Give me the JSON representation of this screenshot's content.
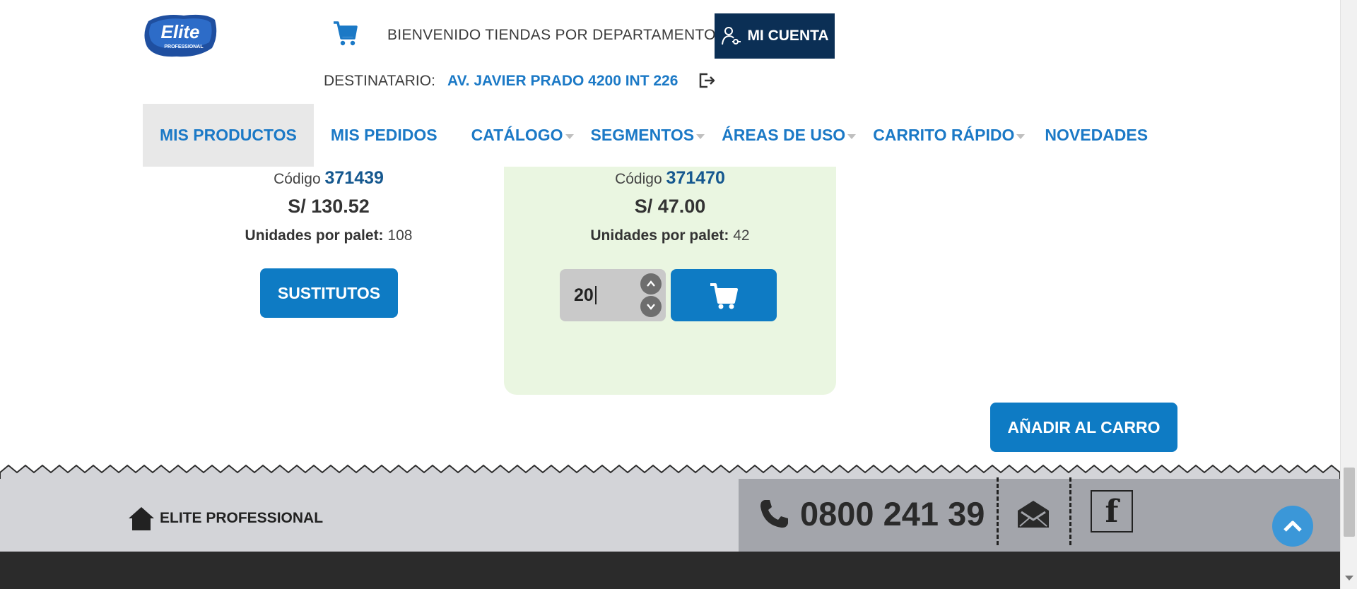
{
  "header": {
    "logo_text": "Elite",
    "logo_subtext": "PROFESSIONAL",
    "welcome": "BIENVENIDO TIENDAS POR DEPARTAMENTO",
    "account_label": "MI CUENTA",
    "dest_label": "DESTINATARIO:",
    "dest_value": "AV. JAVIER PRADO 4200 INT 226"
  },
  "nav": {
    "items": [
      {
        "label": "MIS PRODUCTOS"
      },
      {
        "label": "MIS PEDIDOS"
      },
      {
        "label": "CATÁLOGO"
      },
      {
        "label": "SEGMENTOS"
      },
      {
        "label": "ÁREAS DE USO"
      },
      {
        "label": "CARRITO RÁPIDO"
      },
      {
        "label": "NOVEDADES"
      }
    ]
  },
  "products": [
    {
      "code_label": "Código",
      "code": "371439",
      "price": "S/ 130.52",
      "units_label": "Unidades por palet:",
      "units": "108",
      "action_label": "SUSTITUTOS"
    },
    {
      "code_label": "Código",
      "code": "371470",
      "price": "S/ 47.00",
      "units_label": "Unidades por palet:",
      "units": "42",
      "quantity": "20"
    }
  ],
  "add_to_cart_label": "AÑADIR AL CARRO",
  "footer": {
    "home_label": "ELITE PROFESSIONAL",
    "phone": "0800 241 39",
    "facebook_glyph": "f"
  },
  "colors": {
    "primary_blue": "#0e7bc4",
    "link_blue": "#1b79c6",
    "account_navy": "#0b2f55",
    "highlight_green": "#eaf6e1",
    "footer_light": "#d3d4d8",
    "footer_dark": "#a3a5ab",
    "bottom_bar": "#2b2b2b"
  },
  "icons": [
    "cart-icon",
    "user-key-icon",
    "logout-icon",
    "chevron-up-icon",
    "chevron-down-icon",
    "home-icon",
    "phone-icon",
    "mail-icon",
    "facebook-icon",
    "arrow-up-icon"
  ]
}
